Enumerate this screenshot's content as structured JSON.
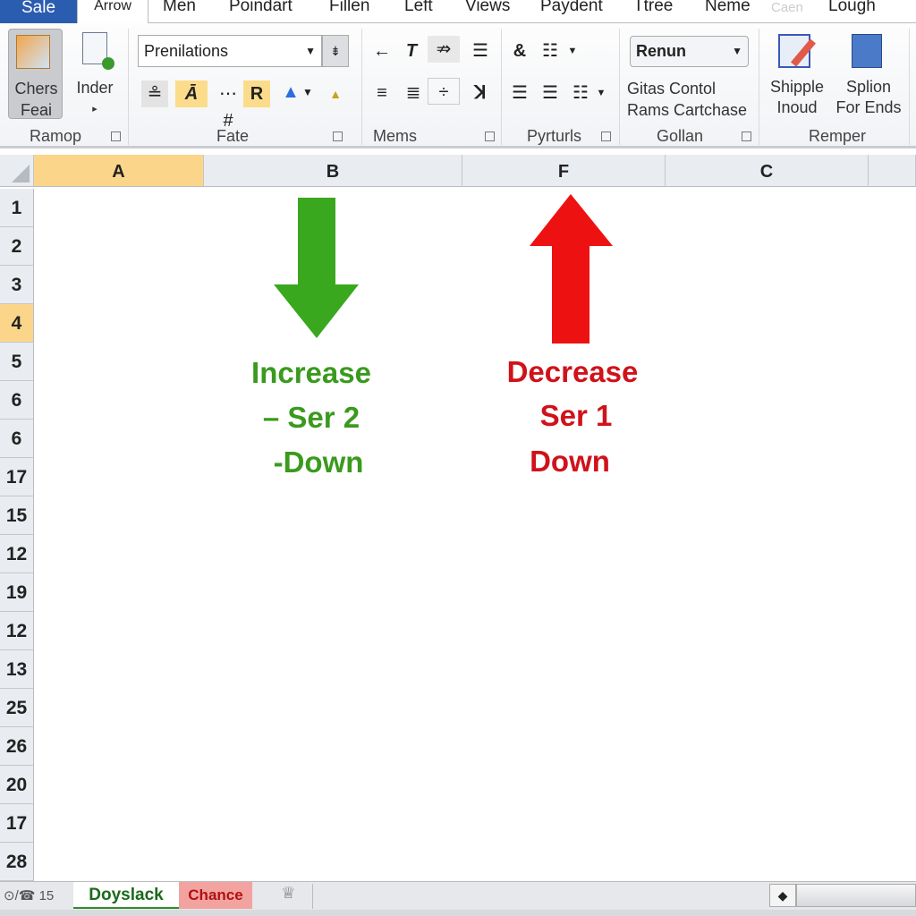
{
  "ribbon_tabs": [
    "Sale",
    "Arrow",
    "Men",
    "Poindart",
    "Fillen",
    "Left",
    "Views",
    "Paydent",
    "Ttree",
    "Neme",
    "Caen",
    "Lough"
  ],
  "groups": {
    "ramop": {
      "label": "Ramop",
      "btn1": "Chers Feai",
      "btn2": "Inder"
    },
    "fate": {
      "label": "Fate",
      "style_combo": "Prenilations"
    },
    "mems": {
      "label": "Mems"
    },
    "pyrturls": {
      "label": "Pyrturls"
    },
    "gollan": {
      "label": "Gollan",
      "combo": "Renun",
      "line1": "Gitas Contol",
      "line2": "Rams Cartchase"
    },
    "remper": {
      "label": "Remper",
      "btn1": "Shipple Inoud",
      "btn2": "Splion For Ends"
    }
  },
  "columns": [
    "A",
    "B",
    "F",
    "C",
    ""
  ],
  "selected_column": "A",
  "rows": [
    "1",
    "2",
    "3",
    "4",
    "5",
    "6",
    "6",
    "17",
    "15",
    "12",
    "19",
    "12",
    "13",
    "25",
    "26",
    "20",
    "17",
    "28"
  ],
  "selected_row": "4",
  "content": {
    "green": {
      "lines": [
        "Increase",
        "– Ser 2",
        "-Down"
      ],
      "color": "#3a9a1e",
      "arrow": "down-arrow"
    },
    "red": {
      "lines": [
        "Decrease",
        "Ser 1",
        "Down"
      ],
      "color": "#d0121b",
      "arrow": "up-arrow"
    }
  },
  "sheet_tabs": {
    "nav": "⊙/☎ 15",
    "tabs": [
      "Doyslack",
      "Chance"
    ]
  }
}
